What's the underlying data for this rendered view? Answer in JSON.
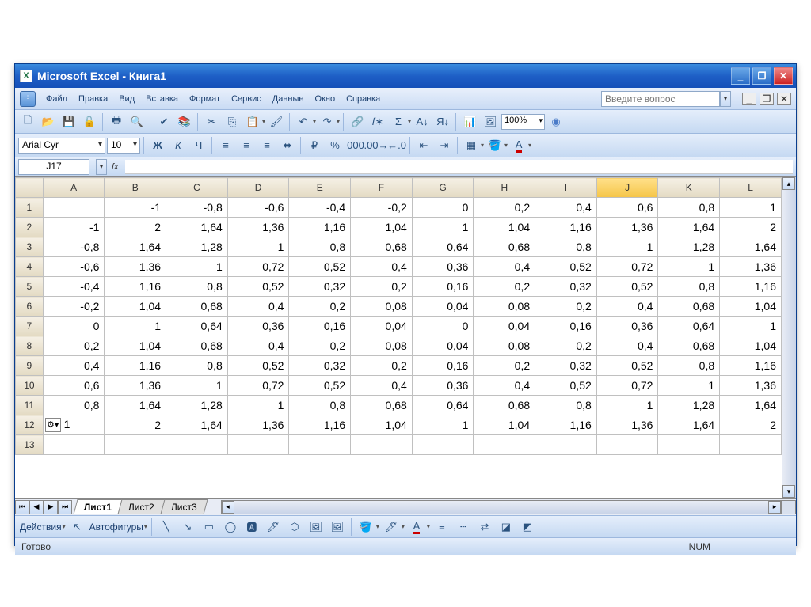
{
  "window": {
    "title": "Microsoft Excel - Книга1"
  },
  "menu": {
    "items": [
      "Файл",
      "Правка",
      "Вид",
      "Вставка",
      "Формат",
      "Сервис",
      "Данные",
      "Окно",
      "Справка"
    ],
    "question_placeholder": "Введите вопрос"
  },
  "formatting": {
    "font": "Arial Cyr",
    "size": "10"
  },
  "namebox": "J17",
  "formula": "",
  "zoom": "100%",
  "columns": [
    "A",
    "B",
    "C",
    "D",
    "E",
    "F",
    "G",
    "H",
    "I",
    "J",
    "K",
    "L"
  ],
  "selected_column": "J",
  "row_count": 13,
  "cells": {
    "1": {
      "B": "-1",
      "C": "-0,8",
      "D": "-0,6",
      "E": "-0,4",
      "F": "-0,2",
      "G": "0",
      "H": "0,2",
      "I": "0,4",
      "J": "0,6",
      "K": "0,8",
      "L": "1"
    },
    "2": {
      "A": "-1",
      "B": "2",
      "C": "1,64",
      "D": "1,36",
      "E": "1,16",
      "F": "1,04",
      "G": "1",
      "H": "1,04",
      "I": "1,16",
      "J": "1,36",
      "K": "1,64",
      "L": "2"
    },
    "3": {
      "A": "-0,8",
      "B": "1,64",
      "C": "1,28",
      "D": "1",
      "E": "0,8",
      "F": "0,68",
      "G": "0,64",
      "H": "0,68",
      "I": "0,8",
      "J": "1",
      "K": "1,28",
      "L": "1,64"
    },
    "4": {
      "A": "-0,6",
      "B": "1,36",
      "C": "1",
      "D": "0,72",
      "E": "0,52",
      "F": "0,4",
      "G": "0,36",
      "H": "0,4",
      "I": "0,52",
      "J": "0,72",
      "K": "1",
      "L": "1,36"
    },
    "5": {
      "A": "-0,4",
      "B": "1,16",
      "C": "0,8",
      "D": "0,52",
      "E": "0,32",
      "F": "0,2",
      "G": "0,16",
      "H": "0,2",
      "I": "0,32",
      "J": "0,52",
      "K": "0,8",
      "L": "1,16"
    },
    "6": {
      "A": "-0,2",
      "B": "1,04",
      "C": "0,68",
      "D": "0,4",
      "E": "0,2",
      "F": "0,08",
      "G": "0,04",
      "H": "0,08",
      "I": "0,2",
      "J": "0,4",
      "K": "0,68",
      "L": "1,04"
    },
    "7": {
      "A": "0",
      "B": "1",
      "C": "0,64",
      "D": "0,36",
      "E": "0,16",
      "F": "0,04",
      "G": "0",
      "H": "0,04",
      "I": "0,16",
      "J": "0,36",
      "K": "0,64",
      "L": "1"
    },
    "8": {
      "A": "0,2",
      "B": "1,04",
      "C": "0,68",
      "D": "0,4",
      "E": "0,2",
      "F": "0,08",
      "G": "0,04",
      "H": "0,08",
      "I": "0,2",
      "J": "0,4",
      "K": "0,68",
      "L": "1,04"
    },
    "9": {
      "A": "0,4",
      "B": "1,16",
      "C": "0,8",
      "D": "0,52",
      "E": "0,32",
      "F": "0,2",
      "G": "0,16",
      "H": "0,2",
      "I": "0,32",
      "J": "0,52",
      "K": "0,8",
      "L": "1,16"
    },
    "10": {
      "A": "0,6",
      "B": "1,36",
      "C": "1",
      "D": "0,72",
      "E": "0,52",
      "F": "0,4",
      "G": "0,36",
      "H": "0,4",
      "I": "0,52",
      "J": "0,72",
      "K": "1",
      "L": "1,36"
    },
    "11": {
      "A": "0,8",
      "B": "1,64",
      "C": "1,28",
      "D": "1",
      "E": "0,8",
      "F": "0,68",
      "G": "0,64",
      "H": "0,68",
      "I": "0,8",
      "J": "1",
      "K": "1,28",
      "L": "1,64"
    },
    "12": {
      "A": "1",
      "B": "2",
      "C": "1,64",
      "D": "1,36",
      "E": "1,16",
      "F": "1,04",
      "G": "1",
      "H": "1,04",
      "I": "1,16",
      "J": "1,36",
      "K": "1,64",
      "L": "2",
      "smart_tag_in": "A"
    }
  },
  "tabs": [
    "Лист1",
    "Лист2",
    "Лист3"
  ],
  "active_tab": 0,
  "drawbar": {
    "actions": "Действия",
    "autoshapes": "Автофигуры"
  },
  "status": {
    "ready": "Готово",
    "numlock": "NUM"
  }
}
